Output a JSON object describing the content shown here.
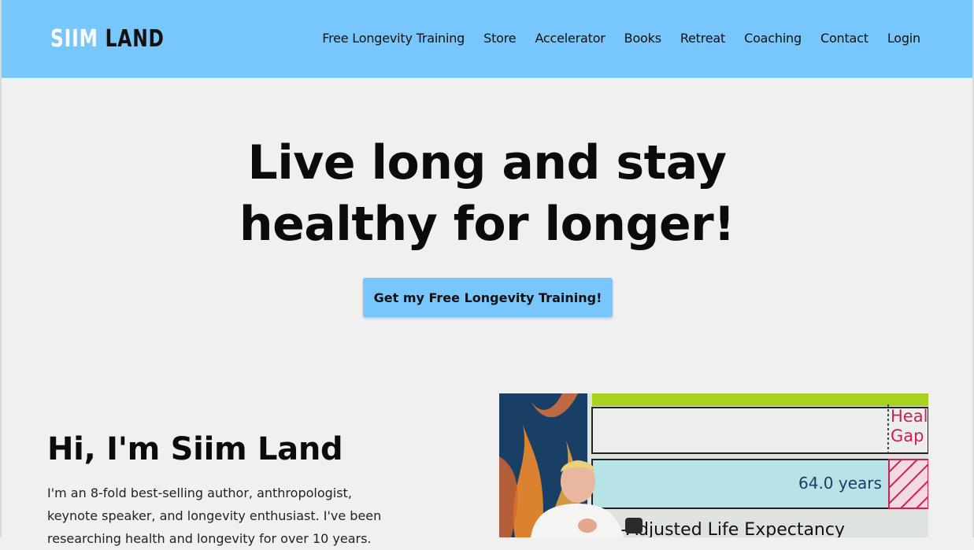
{
  "header": {
    "logo_first": "SIIM",
    "logo_second": "LAND",
    "nav": [
      "Free Longevity Training",
      "Store",
      "Accelerator",
      "Books",
      "Retreat",
      "Coaching",
      "Contact",
      "Login"
    ]
  },
  "hero": {
    "title_line1": "Live long and stay",
    "title_line2": "healthy for longer!",
    "cta_label": "Get my Free Longevity Training!"
  },
  "about": {
    "title": "Hi, I'm Siim Land",
    "text": "I'm an 8-fold best-selling author, anthropologist, keynote speaker, and longevity enthusiast. I've been researching health and longevity for over 10 years."
  },
  "photo": {
    "slide_label_top": "Heal",
    "slide_label_bottom": "Gap",
    "slide_value": "64.0 years",
    "slide_caption": "h-Adjusted Life Expectancy"
  },
  "colors": {
    "header_bg": "#77c7fe",
    "page_bg": "#f0f0f0"
  }
}
